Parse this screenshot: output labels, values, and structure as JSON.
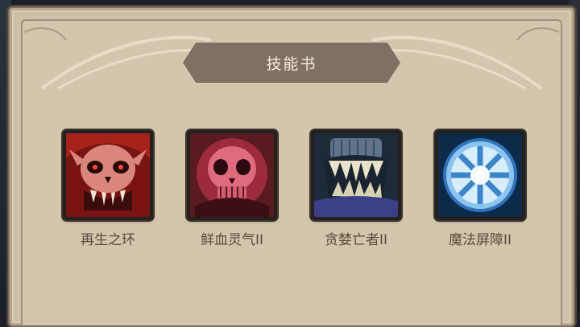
{
  "panel": {
    "title": "技能书"
  },
  "skills": [
    {
      "name": "再生之环",
      "icon": "red-skull-fangs-icon"
    },
    {
      "name": "鲜血灵气II",
      "icon": "pink-skull-icon"
    },
    {
      "name": "贪婪亡者II",
      "icon": "undead-maw-icon"
    },
    {
      "name": "魔法屏障II",
      "icon": "magic-shield-wheel-icon"
    }
  ],
  "colors": {
    "panel_bg": "#d3c6ad",
    "title_bar": "#7e7064",
    "title_text": "#f2ebdd",
    "label_text": "#574b40"
  }
}
